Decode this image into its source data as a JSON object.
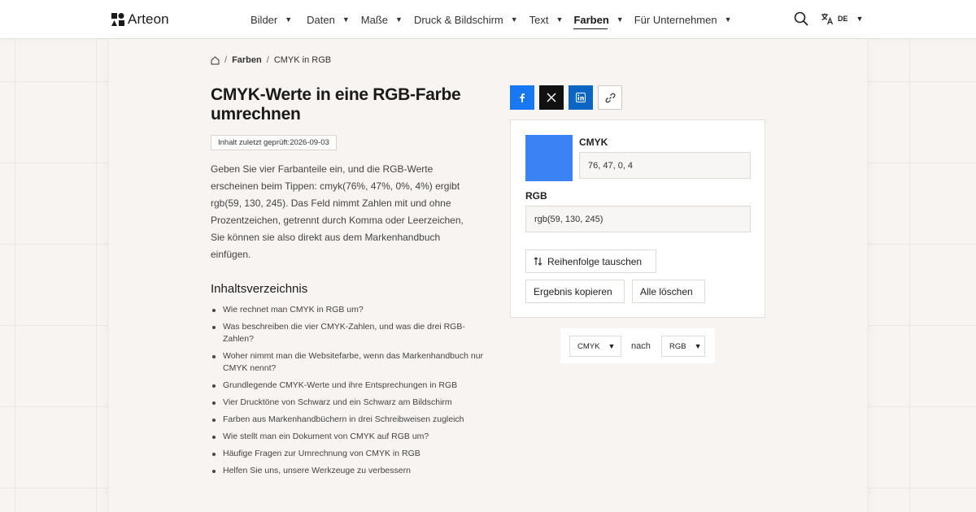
{
  "brand": {
    "name": "Arteon"
  },
  "nav": {
    "items": [
      {
        "label": "Bilder"
      },
      {
        "label": "Daten"
      },
      {
        "label": "Maße"
      },
      {
        "label": "Druck & Bildschirm"
      },
      {
        "label": "Text"
      },
      {
        "label": "Farben",
        "active": true
      },
      {
        "label": "Für Unternehmen"
      }
    ],
    "language": "DE"
  },
  "breadcrumb": {
    "section": "Farben",
    "current": "CMYK in RGB"
  },
  "page": {
    "title": "CMYK-Werte in eine RGB-Farbe umrechnen",
    "badge": "Inhalt zuletzt geprüft:2026-09-03",
    "intro": "Geben Sie vier Farbanteile ein, und die RGB-Werte erscheinen beim Tippen: cmyk(76%, 47%, 0%, 4%) ergibt rgb(59, 130, 245). Das Feld nimmt Zahlen mit und ohne Prozentzeichen, getrennt durch Komma oder Leerzeichen, Sie können sie also direkt aus dem Markenhandbuch einfügen."
  },
  "toc": {
    "title": "Inhaltsverzeichnis",
    "items": [
      "Wie rechnet man CMYK in RGB um?",
      "Was beschreiben die vier CMYK-Zahlen, und was die drei RGB-Zahlen?",
      "Woher nimmt man die Websitefarbe, wenn das Markenhandbuch nur CMYK nennt?",
      "Grundlegende CMYK-Werte und ihre Entsprechungen in RGB",
      "Vier Drucktöne von Schwarz und ein Schwarz am Bildschirm",
      "Farben aus Markenhandbüchern in drei Schreibweisen zugleich",
      "Wie stellt man ein Dokument von CMYK auf RGB um?",
      "Häufige Fragen zur Umrechnung von CMYK in RGB",
      "Helfen Sie uns, unsere Werkzeuge zu verbessern"
    ]
  },
  "share": {
    "icons": [
      "facebook-icon",
      "x-icon",
      "linkedin-icon",
      "link-icon"
    ]
  },
  "converter": {
    "swatch_color": "#3b82f5",
    "cmyk_label": "CMYK",
    "cmyk_value": "76, 47, 0, 4",
    "rgb_label": "RGB",
    "rgb_value": "rgb(59, 130, 245)",
    "swap_label": "Reihenfolge tauschen",
    "copy_label": "Ergebnis kopieren",
    "clear_label": "Alle löschen"
  },
  "units": {
    "from": "CMYK",
    "connector": "nach",
    "to": "RGB"
  },
  "colors": {
    "facebook": "#1877f2",
    "x": "#111111",
    "linkedin": "#0a66c2",
    "swatch": "#3b82f5"
  }
}
